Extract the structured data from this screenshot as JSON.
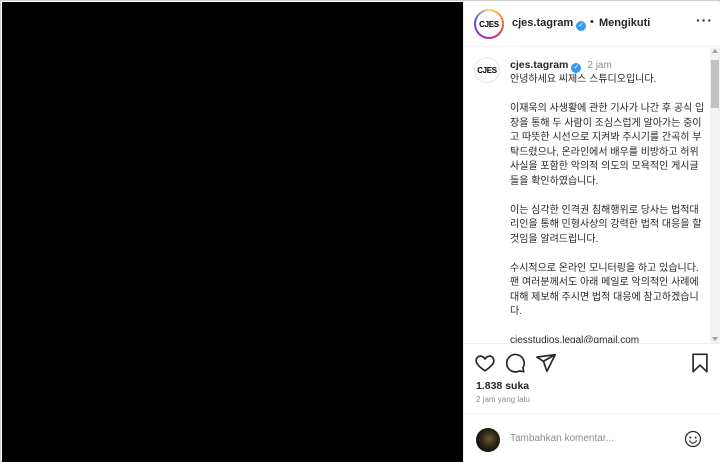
{
  "header": {
    "avatar_text": "CJES",
    "username": "cjes.tagram",
    "separator": "•",
    "follow_label": "Mengikuti",
    "more_label": "···"
  },
  "caption": {
    "avatar_text": "CJES",
    "username": "cjes.tagram",
    "time": "2 jam",
    "paragraphs": [
      "안녕하세요 씨제스 스튜디오입니다.",
      "이재욱의 사생활에 관한 기사가 나간 후 공식 입장을 통해 두 사람이 조심스럽게 알아가는 중이고 따뜻한 시선으로 지켜봐 주시기를 간곡히 부탁드렸으나, 온라인에서 배우를 비방하고 허위 사실을 포함한 악의적 의도의 모욕적인 게시글들을 확인하였습니다.",
      "이는 심각한 인격권 침해행위로 당사는 법적대리인을 통해 민형사상의 강력한 법적 대응을 할 것임을 알려드립니다.",
      "수시적으로 온라인 모니터링을 하고 있습니다. 팬 여러분께서도 아래 메일로 악의적인 사례에 대해 제보해 주시면 법적 대응에 참고하겠습니다.",
      "cjesstudios.legal@gmail.com"
    ]
  },
  "actions": {
    "likes": "1.838 suka",
    "posted": "2 jam yang lalu"
  },
  "comment": {
    "placeholder": "Tambahkan komentar..."
  },
  "icons": [
    "heart-icon",
    "comment-icon",
    "share-icon",
    "bookmark-icon",
    "emoji-icon",
    "verified-badge-icon",
    "more-icon"
  ]
}
